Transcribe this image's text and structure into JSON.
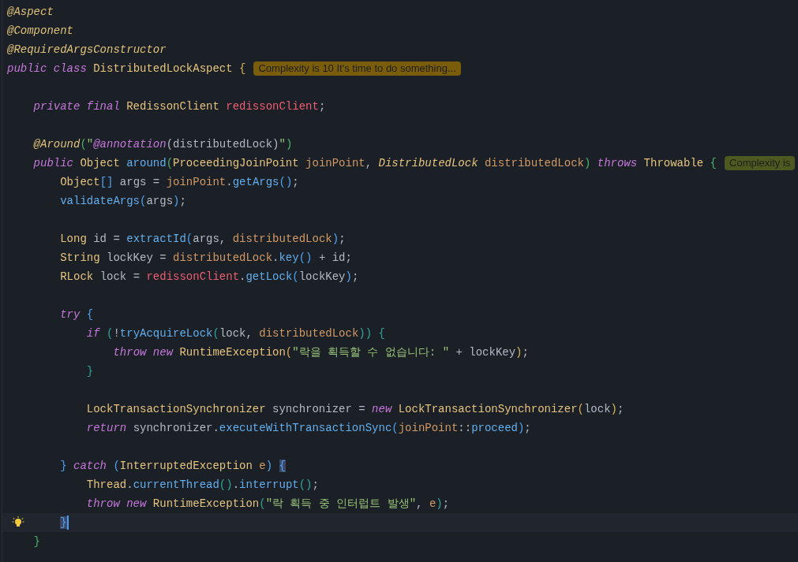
{
  "editor": {
    "blocks": [
      {
        "lines": [
          {
            "current": false,
            "tokens": [
              {
                "kind": "ann",
                "text": "@Aspect"
              }
            ]
          },
          {
            "current": false,
            "tokens": [
              {
                "kind": "ann",
                "text": "@Component"
              }
            ]
          },
          {
            "current": false,
            "tokens": [
              {
                "kind": "ann",
                "text": "@RequiredArgsConstructor"
              }
            ]
          },
          {
            "current": false,
            "tokens": [
              {
                "kind": "kw",
                "text": "public class "
              },
              {
                "kind": "type",
                "text": "DistributedLockAspect "
              },
              {
                "kind": "gold",
                "text": "{"
              }
            ],
            "hint": {
              "kind": "warning",
              "text": "Complexity is 10 It's time to do something..."
            }
          }
        ]
      },
      {
        "lines": [
          {
            "current": false,
            "tokens": [
              {
                "kind": "kw",
                "text": "    private final "
              },
              {
                "kind": "type",
                "text": "RedissonClient "
              },
              {
                "kind": "field",
                "text": "redissonClient"
              },
              {
                "kind": "plain",
                "text": ";"
              }
            ]
          }
        ]
      },
      {
        "lines": [
          {
            "current": false,
            "tokens": [
              {
                "kind": "ann",
                "text": "    @Around"
              },
              {
                "kind": "green",
                "text": "("
              },
              {
                "kind": "str",
                "text": "\""
              },
              {
                "kind": "kw",
                "text": "@annotation"
              },
              {
                "kind": "plain",
                "text": "(distributedLock)"
              },
              {
                "kind": "str",
                "text": "\""
              },
              {
                "kind": "green",
                "text": ")"
              }
            ]
          },
          {
            "current": false,
            "tokens": [
              {
                "kind": "kw",
                "text": "    public "
              },
              {
                "kind": "type",
                "text": "Object "
              },
              {
                "kind": "fn",
                "text": "around"
              },
              {
                "kind": "green",
                "text": "("
              },
              {
                "kind": "type",
                "text": "ProceedingJoinPoint "
              },
              {
                "kind": "param",
                "text": "joinPoint"
              },
              {
                "kind": "plain",
                "text": ", "
              },
              {
                "kind": "typei",
                "text": "DistributedLock "
              },
              {
                "kind": "param",
                "text": "distributedLock"
              },
              {
                "kind": "green",
                "text": ")"
              },
              {
                "kind": "kw",
                "text": " throws "
              },
              {
                "kind": "type",
                "text": "Throwable "
              },
              {
                "kind": "green",
                "text": "{"
              }
            ],
            "hint": {
              "kind": "ok",
              "text": "Complexity is"
            }
          },
          {
            "current": false,
            "tokens": [
              {
                "kind": "type",
                "text": "        Object"
              },
              {
                "kind": "blue",
                "text": "[]"
              },
              {
                "kind": "plain",
                "text": " args = "
              },
              {
                "kind": "param",
                "text": "joinPoint"
              },
              {
                "kind": "plain",
                "text": "."
              },
              {
                "kind": "fn",
                "text": "getArgs"
              },
              {
                "kind": "blue",
                "text": "()"
              },
              {
                "kind": "plain",
                "text": ";"
              }
            ]
          },
          {
            "current": false,
            "tokens": [
              {
                "kind": "fn",
                "text": "        validateArgs"
              },
              {
                "kind": "blue",
                "text": "("
              },
              {
                "kind": "plain",
                "text": "args"
              },
              {
                "kind": "blue",
                "text": ")"
              },
              {
                "kind": "plain",
                "text": ";"
              }
            ]
          }
        ]
      },
      {
        "lines": [
          {
            "current": false,
            "tokens": [
              {
                "kind": "type",
                "text": "        Long "
              },
              {
                "kind": "plain",
                "text": "id = "
              },
              {
                "kind": "fn",
                "text": "extractId"
              },
              {
                "kind": "blue",
                "text": "("
              },
              {
                "kind": "plain",
                "text": "args, "
              },
              {
                "kind": "param",
                "text": "distributedLock"
              },
              {
                "kind": "blue",
                "text": ")"
              },
              {
                "kind": "plain",
                "text": ";"
              }
            ]
          },
          {
            "current": false,
            "tokens": [
              {
                "kind": "type",
                "text": "        String "
              },
              {
                "kind": "plain",
                "text": "lockKey = "
              },
              {
                "kind": "param",
                "text": "distributedLock"
              },
              {
                "kind": "plain",
                "text": "."
              },
              {
                "kind": "fn",
                "text": "key"
              },
              {
                "kind": "blue",
                "text": "()"
              },
              {
                "kind": "plain",
                "text": " + id;"
              }
            ]
          },
          {
            "current": false,
            "tokens": [
              {
                "kind": "type",
                "text": "        RLock "
              },
              {
                "kind": "plain",
                "text": "lock = "
              },
              {
                "kind": "field",
                "text": "redissonClient"
              },
              {
                "kind": "plain",
                "text": "."
              },
              {
                "kind": "fn",
                "text": "getLock"
              },
              {
                "kind": "blue",
                "text": "("
              },
              {
                "kind": "plain",
                "text": "lockKey"
              },
              {
                "kind": "blue",
                "text": ")"
              },
              {
                "kind": "plain",
                "text": ";"
              }
            ]
          }
        ]
      },
      {
        "lines": [
          {
            "current": false,
            "tokens": [
              {
                "kind": "kw",
                "text": "        try "
              },
              {
                "kind": "blue",
                "text": "{"
              }
            ]
          },
          {
            "current": false,
            "tokens": [
              {
                "kind": "kw",
                "text": "            if "
              },
              {
                "kind": "teal",
                "text": "("
              },
              {
                "kind": "plain",
                "text": "!"
              },
              {
                "kind": "fn",
                "text": "tryAcquireLock"
              },
              {
                "kind": "teal",
                "text": "("
              },
              {
                "kind": "plain",
                "text": "lock, "
              },
              {
                "kind": "param",
                "text": "distributedLock"
              },
              {
                "kind": "teal",
                "text": ")) {"
              }
            ]
          },
          {
            "current": false,
            "tokens": [
              {
                "kind": "kw",
                "text": "                throw new "
              },
              {
                "kind": "type",
                "text": "RuntimeException"
              },
              {
                "kind": "gold",
                "text": "("
              },
              {
                "kind": "str",
                "text": "\"락을 획득할 수 없습니다: \""
              },
              {
                "kind": "plain",
                "text": " + lockKey"
              },
              {
                "kind": "gold",
                "text": ")"
              },
              {
                "kind": "plain",
                "text": ";"
              }
            ]
          },
          {
            "current": false,
            "tokens": [
              {
                "kind": "teal",
                "text": "            }"
              }
            ]
          }
        ]
      },
      {
        "lines": [
          {
            "current": false,
            "tokens": [
              {
                "kind": "type",
                "text": "            LockTransactionSynchronizer "
              },
              {
                "kind": "plain",
                "text": "synchronizer = "
              },
              {
                "kind": "kw",
                "text": "new "
              },
              {
                "kind": "type",
                "text": "LockTransactionSynchronizer"
              },
              {
                "kind": "gold",
                "text": "("
              },
              {
                "kind": "plain",
                "text": "lock"
              },
              {
                "kind": "gold",
                "text": ")"
              },
              {
                "kind": "plain",
                "text": ";"
              }
            ]
          },
          {
            "current": false,
            "tokens": [
              {
                "kind": "kw",
                "text": "            return "
              },
              {
                "kind": "plain",
                "text": "synchronizer."
              },
              {
                "kind": "fn",
                "text": "executeWithTransactionSync"
              },
              {
                "kind": "blue",
                "text": "("
              },
              {
                "kind": "param",
                "text": "joinPoint"
              },
              {
                "kind": "plain",
                "text": "::"
              },
              {
                "kind": "fn",
                "text": "proceed"
              },
              {
                "kind": "blue",
                "text": ")"
              },
              {
                "kind": "plain",
                "text": ";"
              }
            ]
          }
        ]
      },
      {
        "lines": [
          {
            "current": false,
            "tokens": [
              {
                "kind": "blue",
                "text": "        } "
              },
              {
                "kind": "kw",
                "text": "catch "
              },
              {
                "kind": "blue",
                "text": "("
              },
              {
                "kind": "type",
                "text": "InterruptedException "
              },
              {
                "kind": "param",
                "text": "e"
              },
              {
                "kind": "blue",
                "text": ") "
              },
              {
                "kind": "match",
                "text": "{"
              }
            ]
          },
          {
            "current": false,
            "tokens": [
              {
                "kind": "type",
                "text": "            Thread"
              },
              {
                "kind": "plain",
                "text": "."
              },
              {
                "kind": "fn",
                "text": "currentThread"
              },
              {
                "kind": "teal",
                "text": "()"
              },
              {
                "kind": "plain",
                "text": "."
              },
              {
                "kind": "fn",
                "text": "interrupt"
              },
              {
                "kind": "teal",
                "text": "()"
              },
              {
                "kind": "plain",
                "text": ";"
              }
            ]
          },
          {
            "current": false,
            "tokens": [
              {
                "kind": "kw",
                "text": "            throw new "
              },
              {
                "kind": "type",
                "text": "RuntimeException"
              },
              {
                "kind": "teal",
                "text": "("
              },
              {
                "kind": "str",
                "text": "\"락 획득 중 인터럽트 발생\""
              },
              {
                "kind": "plain",
                "text": ", "
              },
              {
                "kind": "param",
                "text": "e"
              },
              {
                "kind": "teal",
                "text": ")"
              },
              {
                "kind": "plain",
                "text": ";"
              }
            ]
          },
          {
            "current": true,
            "tokens": [
              {
                "kind": "match",
                "text": "        }"
              }
            ]
          },
          {
            "current": false,
            "tokens": [
              {
                "kind": "green",
                "text": "    }"
              }
            ]
          }
        ]
      }
    ]
  }
}
